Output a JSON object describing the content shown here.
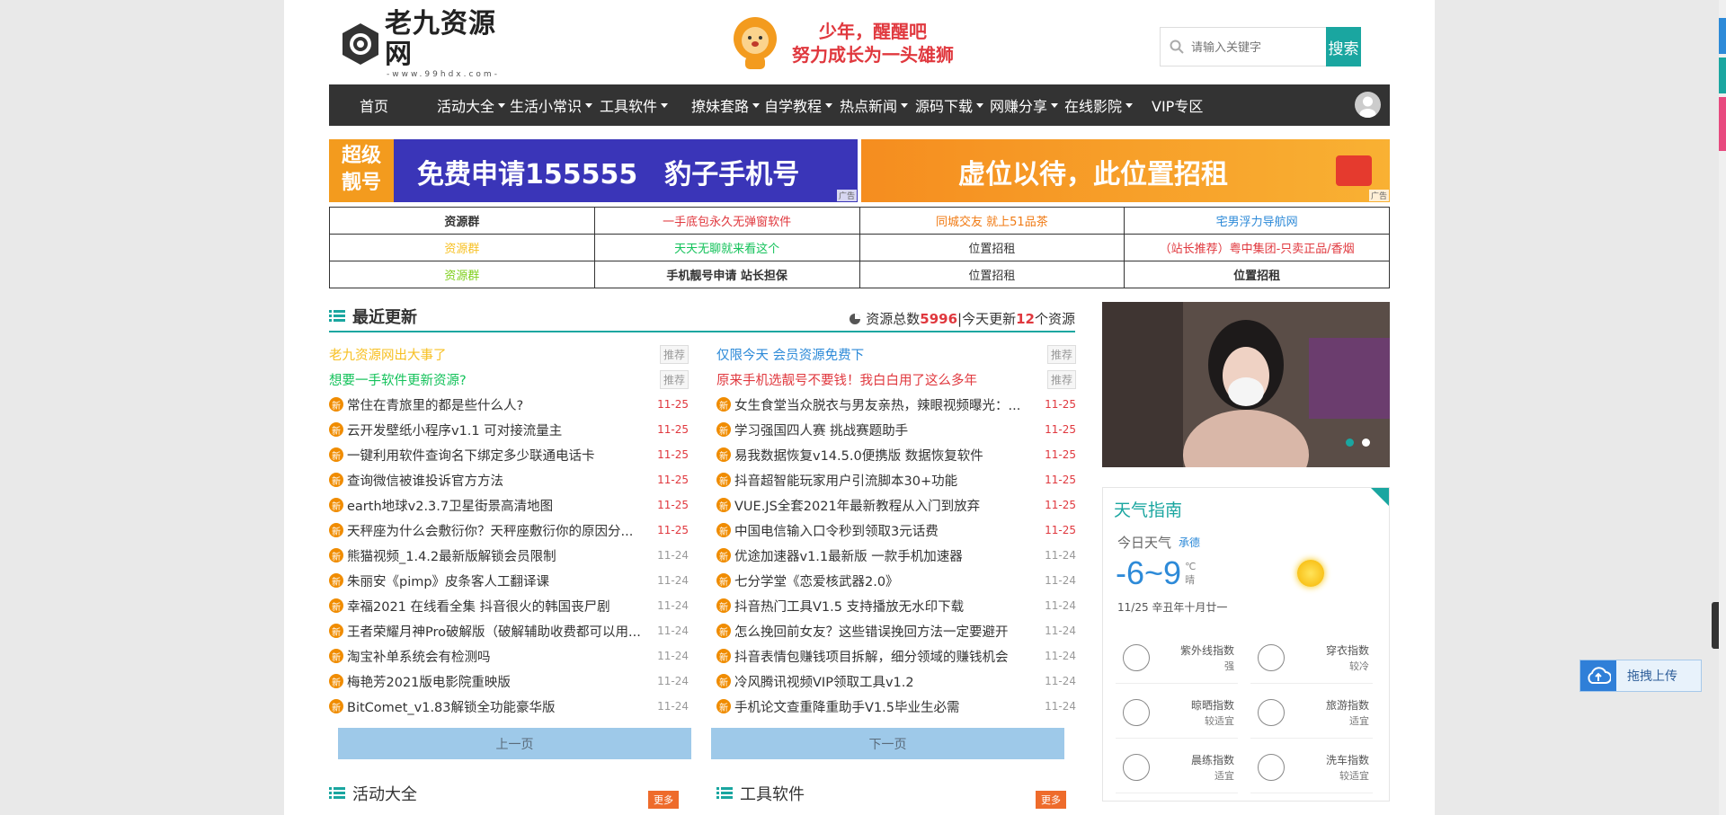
{
  "header": {
    "logo_title": "老九资源网",
    "logo_url": "-www.99hdx.com-",
    "slogan_line1": "少年，醒醒吧",
    "slogan_line2": "努力成长为一头雄狮",
    "search_placeholder": "请输入关键字",
    "search_button": "搜索"
  },
  "nav": [
    {
      "label": "首页",
      "dropdown": false
    },
    {
      "label": "活动大全",
      "dropdown": true
    },
    {
      "label": "生活小常识",
      "dropdown": true
    },
    {
      "label": "工具软件",
      "dropdown": true
    },
    {
      "label": "撩妹套路",
      "dropdown": true
    },
    {
      "label": "自学教程",
      "dropdown": true
    },
    {
      "label": "热点新闻",
      "dropdown": true
    },
    {
      "label": "源码下载",
      "dropdown": true
    },
    {
      "label": "网赚分享",
      "dropdown": true
    },
    {
      "label": "在线影院",
      "dropdown": true
    },
    {
      "label": "VIP专区",
      "dropdown": false
    }
  ],
  "ads": {
    "left_badge_1": "超级",
    "left_badge_2": "靓号",
    "left_text": "免费申请155555　豹子手机号",
    "right_text": "虚位以待，此位置招租",
    "tag": "广告"
  },
  "link_table": [
    [
      {
        "text": "资源群",
        "color": "#333",
        "bold": true
      },
      {
        "text": "一手底包永久无弹窗软件",
        "color": "#e0383e"
      },
      {
        "text": "同城交友 就上51品茶",
        "color": "#f07a13"
      },
      {
        "text": "宅男浮力导航网",
        "color": "#2d8ad8"
      }
    ],
    [
      {
        "text": "资源群",
        "color": "#f7c023"
      },
      {
        "text": "天天无聊就来看这个",
        "color": "#13c25a"
      },
      {
        "text": "位置招租",
        "color": "#333"
      },
      {
        "text": "（站长推荐）粤中集团-只卖正品/香烟",
        "color": "#e0383e"
      }
    ],
    [
      {
        "text": "资源群",
        "color": "#7fcf1c"
      },
      {
        "text": "手机靓号申请 站长担保",
        "color": "#333",
        "bold": true
      },
      {
        "text": "位置招租",
        "color": "#333"
      },
      {
        "text": "位置招租",
        "color": "#333",
        "bold": true
      }
    ]
  ],
  "recent": {
    "title": "最近更新",
    "stats_prefix": "资源总数",
    "total": "5996",
    "stats_mid": "|今天更新",
    "today": "12",
    "stats_suffix": "个资源",
    "rec_label": "推荐",
    "new_label": "新",
    "left_pinned": [
      {
        "text": "老九资源网出大事了",
        "color": "#f7c023"
      },
      {
        "text": "想要一手软件更新资源?",
        "color": "#13c25a"
      }
    ],
    "right_pinned": [
      {
        "text": "仅限今天 会员资源免费下",
        "color": "#2d8ad8"
      },
      {
        "text": "原来手机选靓号不要钱！我白白用了这么多年",
        "color": "#e0383e"
      }
    ],
    "left_items": [
      {
        "text": "常住在青旅里的都是些什么人?",
        "date": "11-25"
      },
      {
        "text": "云开发壁纸小程序v1.1 可对接流量主",
        "date": "11-25"
      },
      {
        "text": "一键利用软件查询名下绑定多少联通电话卡",
        "date": "11-25"
      },
      {
        "text": "查询微信被谁投诉官方方法",
        "date": "11-25"
      },
      {
        "text": "earth地球v2.3.7卫星街景高清地图",
        "date": "11-25"
      },
      {
        "text": "天秤座为什么会敷衍你？天秤座敷衍你的原因分...",
        "date": "11-25"
      },
      {
        "text": "熊猫视频_1.4.2最新版解锁会员限制",
        "date": "11-24"
      },
      {
        "text": "朱丽安《pimp》皮条客人工翻译课",
        "date": "11-24"
      },
      {
        "text": "幸福2021 在线看全集 抖音很火的韩国丧尸剧",
        "date": "11-24"
      },
      {
        "text": "王者荣耀月神Pro破解版（破解辅助收费都可以用...",
        "date": "11-24"
      },
      {
        "text": "淘宝补单系统会有检测吗",
        "date": "11-24"
      },
      {
        "text": "梅艳芳2021版电影院重映版",
        "date": "11-24"
      },
      {
        "text": "BitComet_v1.83解锁全功能豪华版",
        "date": "11-24"
      }
    ],
    "right_items": [
      {
        "text": "女生食堂当众脱衣与男友亲热，辣眼视频曝光：...",
        "date": "11-25"
      },
      {
        "text": "学习强国四人赛 挑战赛题助手",
        "date": "11-25"
      },
      {
        "text": "易我数据恢复v14.5.0便携版 数据恢复软件",
        "date": "11-25"
      },
      {
        "text": "抖音超智能玩家用户引流脚本30+功能",
        "date": "11-25"
      },
      {
        "text": "VUE.JS全套2021年最新教程从入门到放弃",
        "date": "11-25"
      },
      {
        "text": "中国电信输入口令秒到领取3元话费",
        "date": "11-25"
      },
      {
        "text": "优途加速器v1.1最新版 一款手机加速器",
        "date": "11-24"
      },
      {
        "text": "七分学堂《恋爱核武器2.0》",
        "date": "11-24"
      },
      {
        "text": "抖音热门工具V1.5 支持播放无水印下载",
        "date": "11-24"
      },
      {
        "text": "怎么挽回前女友？这些错误挽回方法一定要避开",
        "date": "11-24"
      },
      {
        "text": "抖音表情包赚钱项目拆解，细分领域的赚钱机会",
        "date": "11-24"
      },
      {
        "text": "冷风腾讯视频VIP领取工具v1.2",
        "date": "11-24"
      },
      {
        "text": "手机论文查重降重助手V1.5毕业生必需",
        "date": "11-24"
      }
    ],
    "prev": "上一页",
    "next": "下一页"
  },
  "sections": {
    "activities": "活动大全",
    "tools": "工具软件",
    "more": "更多"
  },
  "weather": {
    "title": "天气指南",
    "today_label": "今日天气",
    "city": "承德",
    "temp": "-6~9",
    "unit": "℃",
    "cond": "晴",
    "date": "11/25 辛丑年十月廿一",
    "indices": [
      {
        "name": "紫外线指数",
        "value": "强"
      },
      {
        "name": "穿衣指数",
        "value": "较冷"
      },
      {
        "name": "晾晒指数",
        "value": "较适宜"
      },
      {
        "name": "旅游指数",
        "value": "适宜"
      },
      {
        "name": "晨练指数",
        "value": "适宜"
      },
      {
        "name": "洗车指数",
        "value": "较适宜"
      }
    ]
  },
  "float": {
    "upload": "拖拽上传"
  },
  "colors": {
    "accent": "#1aa6a0",
    "nav_bg": "#333333",
    "date_red": "#e0383e",
    "new_badge": "#f08c00",
    "pager": "#9ec9e9"
  }
}
